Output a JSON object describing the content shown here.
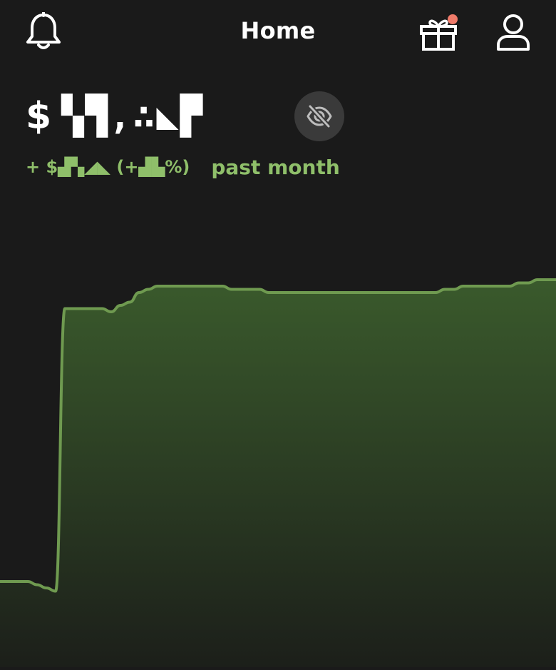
{
  "header": {
    "title": "Home",
    "icons": {
      "notifications": "bell-icon",
      "rewards": "gift-icon",
      "account": "profile-icon"
    },
    "gift_badge_color": "#f07b6a"
  },
  "balance": {
    "currency": "$",
    "value": "▚▜,∴◣▛",
    "hide_icon": "eye-off-icon"
  },
  "change": {
    "value": "+ $▟▚◢◣ (+▟▙%)",
    "period": "past month"
  },
  "colors": {
    "background": "#1a1a1a",
    "accent": "#8fbf6a",
    "chart_line": "#6f9a50",
    "chart_fill_top": "#3a5a2c",
    "chart_fill_bottom": "#1c1f1a"
  },
  "chart_data": {
    "type": "area",
    "x": [
      0,
      1,
      2,
      3,
      4,
      5,
      6,
      7,
      8,
      9,
      10,
      11,
      12,
      13,
      14,
      15,
      16,
      17,
      18,
      19,
      20,
      21,
      22,
      23,
      24,
      25,
      26,
      27,
      28,
      29,
      30,
      31,
      32,
      33,
      34,
      35,
      36,
      37,
      38,
      39,
      40,
      41,
      42,
      43,
      44,
      45,
      46,
      47,
      48,
      49,
      50,
      51,
      52,
      53,
      54,
      55,
      56,
      57,
      58,
      59,
      60
    ],
    "values": [
      10,
      10,
      10,
      10,
      9,
      8,
      7,
      95,
      95,
      95,
      95,
      95,
      94,
      96,
      97,
      100,
      101,
      102,
      102,
      102,
      102,
      102,
      102,
      102,
      102,
      101,
      101,
      101,
      101,
      100,
      100,
      100,
      100,
      100,
      100,
      100,
      100,
      100,
      100,
      100,
      100,
      100,
      100,
      100,
      100,
      100,
      100,
      100,
      101,
      101,
      102,
      102,
      102,
      102,
      102,
      102,
      103,
      103,
      104,
      104,
      104
    ],
    "ylim": [
      0,
      110
    ],
    "grid": false,
    "title": "",
    "xlabel": "",
    "ylabel": ""
  }
}
